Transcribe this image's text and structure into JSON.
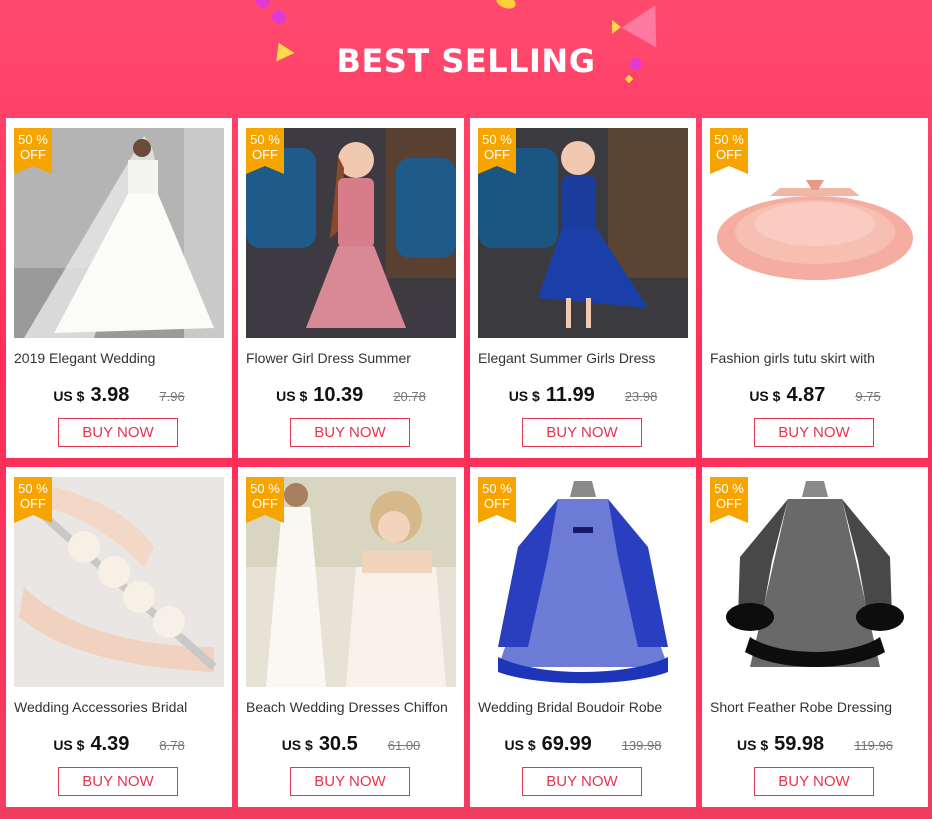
{
  "header": {
    "title": "BEST SELLING"
  },
  "products": [
    {
      "name": "2019 Elegant Wedding",
      "currency": "US $",
      "price": "3.98",
      "old_price": "7.96",
      "discount": "50 %",
      "discount_label": "OFF",
      "cta": "BUY NOW"
    },
    {
      "name": "Flower Girl Dress Summer",
      "currency": "US $",
      "price": "10.39",
      "old_price": "20.78",
      "discount": "50 %",
      "discount_label": "OFF",
      "cta": "BUY NOW"
    },
    {
      "name": "Elegant Summer Girls Dress",
      "currency": "US $",
      "price": "11.99",
      "old_price": "23.98",
      "discount": "50 %",
      "discount_label": "OFF",
      "cta": "BUY NOW"
    },
    {
      "name": "Fashion girls tutu skirt with",
      "currency": "US $",
      "price": "4.87",
      "old_price": "9.75",
      "discount": "50 %",
      "discount_label": "OFF",
      "cta": "BUY NOW"
    },
    {
      "name": "Wedding Accessories Bridal",
      "currency": "US $",
      "price": "4.39",
      "old_price": "8.78",
      "discount": "50 %",
      "discount_label": "OFF",
      "cta": "BUY NOW"
    },
    {
      "name": "Beach Wedding Dresses Chiffon",
      "currency": "US $",
      "price": "30.5",
      "old_price": "61.00",
      "discount": "50 %",
      "discount_label": "OFF",
      "cta": "BUY NOW"
    },
    {
      "name": "Wedding Bridal Boudoir Robe",
      "currency": "US $",
      "price": "69.99",
      "old_price": "139.98",
      "discount": "50 %",
      "discount_label": "OFF",
      "cta": "BUY NOW"
    },
    {
      "name": "Short Feather Robe Dressing",
      "currency": "US $",
      "price": "59.98",
      "old_price": "119.96",
      "discount": "50 %",
      "discount_label": "OFF",
      "cta": "BUY NOW"
    }
  ]
}
